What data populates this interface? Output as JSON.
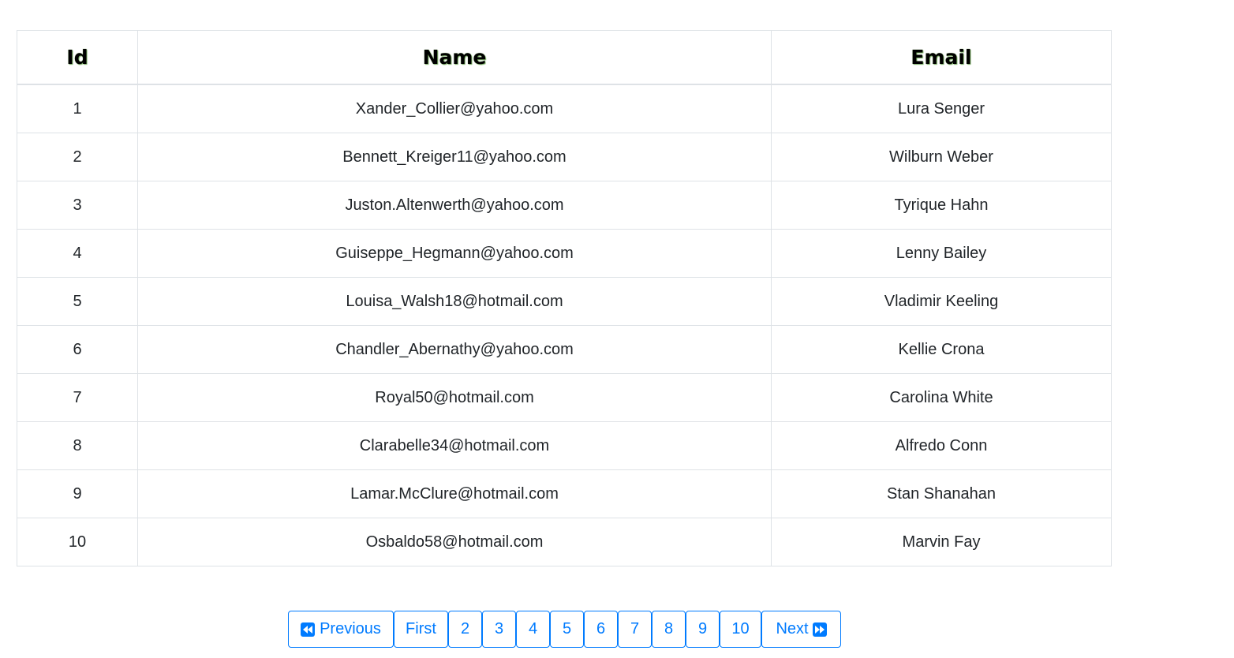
{
  "table": {
    "headers": [
      "Id",
      "Name",
      "Email"
    ],
    "rows": [
      [
        "1",
        "Xander_Collier@yahoo.com",
        "Lura Senger"
      ],
      [
        "2",
        "Bennett_Kreiger11@yahoo.com",
        "Wilburn Weber"
      ],
      [
        "3",
        "Juston.Altenwerth@yahoo.com",
        "Tyrique Hahn"
      ],
      [
        "4",
        "Guiseppe_Hegmann@yahoo.com",
        "Lenny Bailey"
      ],
      [
        "5",
        "Louisa_Walsh18@hotmail.com",
        "Vladimir Keeling"
      ],
      [
        "6",
        "Chandler_Abernathy@yahoo.com",
        "Kellie Crona"
      ],
      [
        "7",
        "Royal50@hotmail.com",
        "Carolina White"
      ],
      [
        "8",
        "Clarabelle34@hotmail.com",
        "Alfredo Conn"
      ],
      [
        "9",
        "Lamar.McClure@hotmail.com",
        "Stan Shanahan"
      ],
      [
        "10",
        "Osbaldo58@hotmail.com",
        "Marvin Fay"
      ]
    ]
  },
  "pagination": {
    "previous_label": "Previous",
    "previous_icon": "backward-icon",
    "first_label": "First",
    "pages": [
      "2",
      "3",
      "4",
      "5",
      "6",
      "7",
      "8",
      "9",
      "10"
    ],
    "next_label": "Next",
    "next_icon": "forward-icon",
    "accent_color": "#007bff"
  }
}
